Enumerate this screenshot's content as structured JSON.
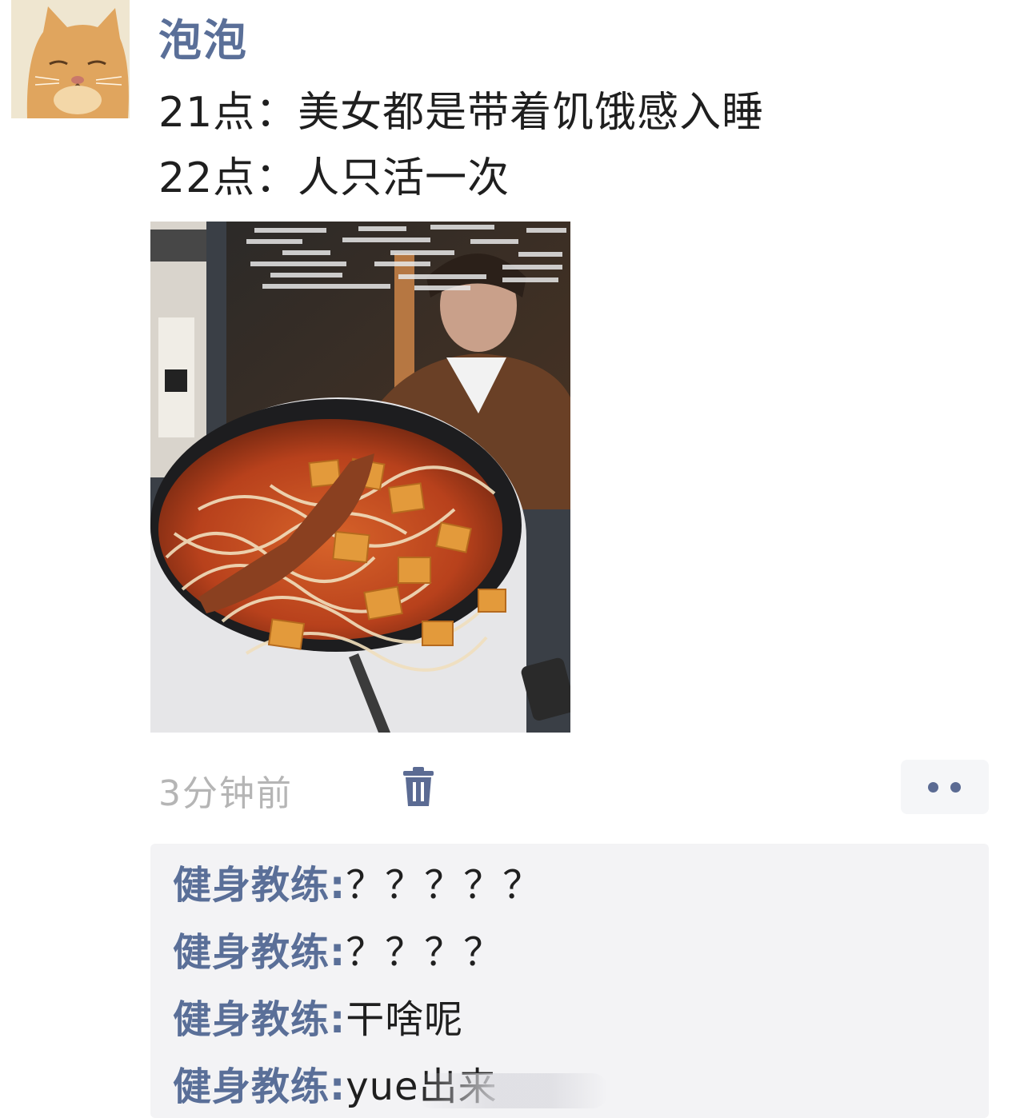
{
  "post": {
    "author": "泡泡",
    "lines": [
      "21点：美女都是带着饥饿感入睡",
      "22点：人只活一次"
    ],
    "timestamp": "3分钟前"
  },
  "icons": {
    "avatar": "cat-avatar",
    "delete": "trash-icon",
    "more": "more-dots-icon"
  },
  "comments": [
    {
      "author": "健身教练",
      "colon": ":",
      "text": "？？？？？"
    },
    {
      "author": "健身教练",
      "colon": ":",
      "text": "？？？？"
    },
    {
      "author": "健身教练",
      "colon": ":",
      "text": "干啥呢"
    },
    {
      "author": "健身教练",
      "colon": ":",
      "text": "yue出来"
    }
  ],
  "colors": {
    "name_blue": "#5a6f98",
    "text": "#1f1f1f",
    "time": "#b5b5b5",
    "comment_bg": "#f3f3f5"
  }
}
